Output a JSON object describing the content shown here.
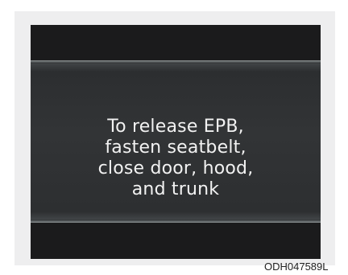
{
  "display": {
    "message_lines": [
      "To release EPB,",
      "fasten seatbelt,",
      "close door, hood,",
      "and trunk"
    ]
  },
  "figure": {
    "code": "ODH047589L"
  },
  "colors": {
    "screen_background": "#1b1b1c",
    "panel_background": "#323436",
    "text": "#f2f2f2"
  }
}
